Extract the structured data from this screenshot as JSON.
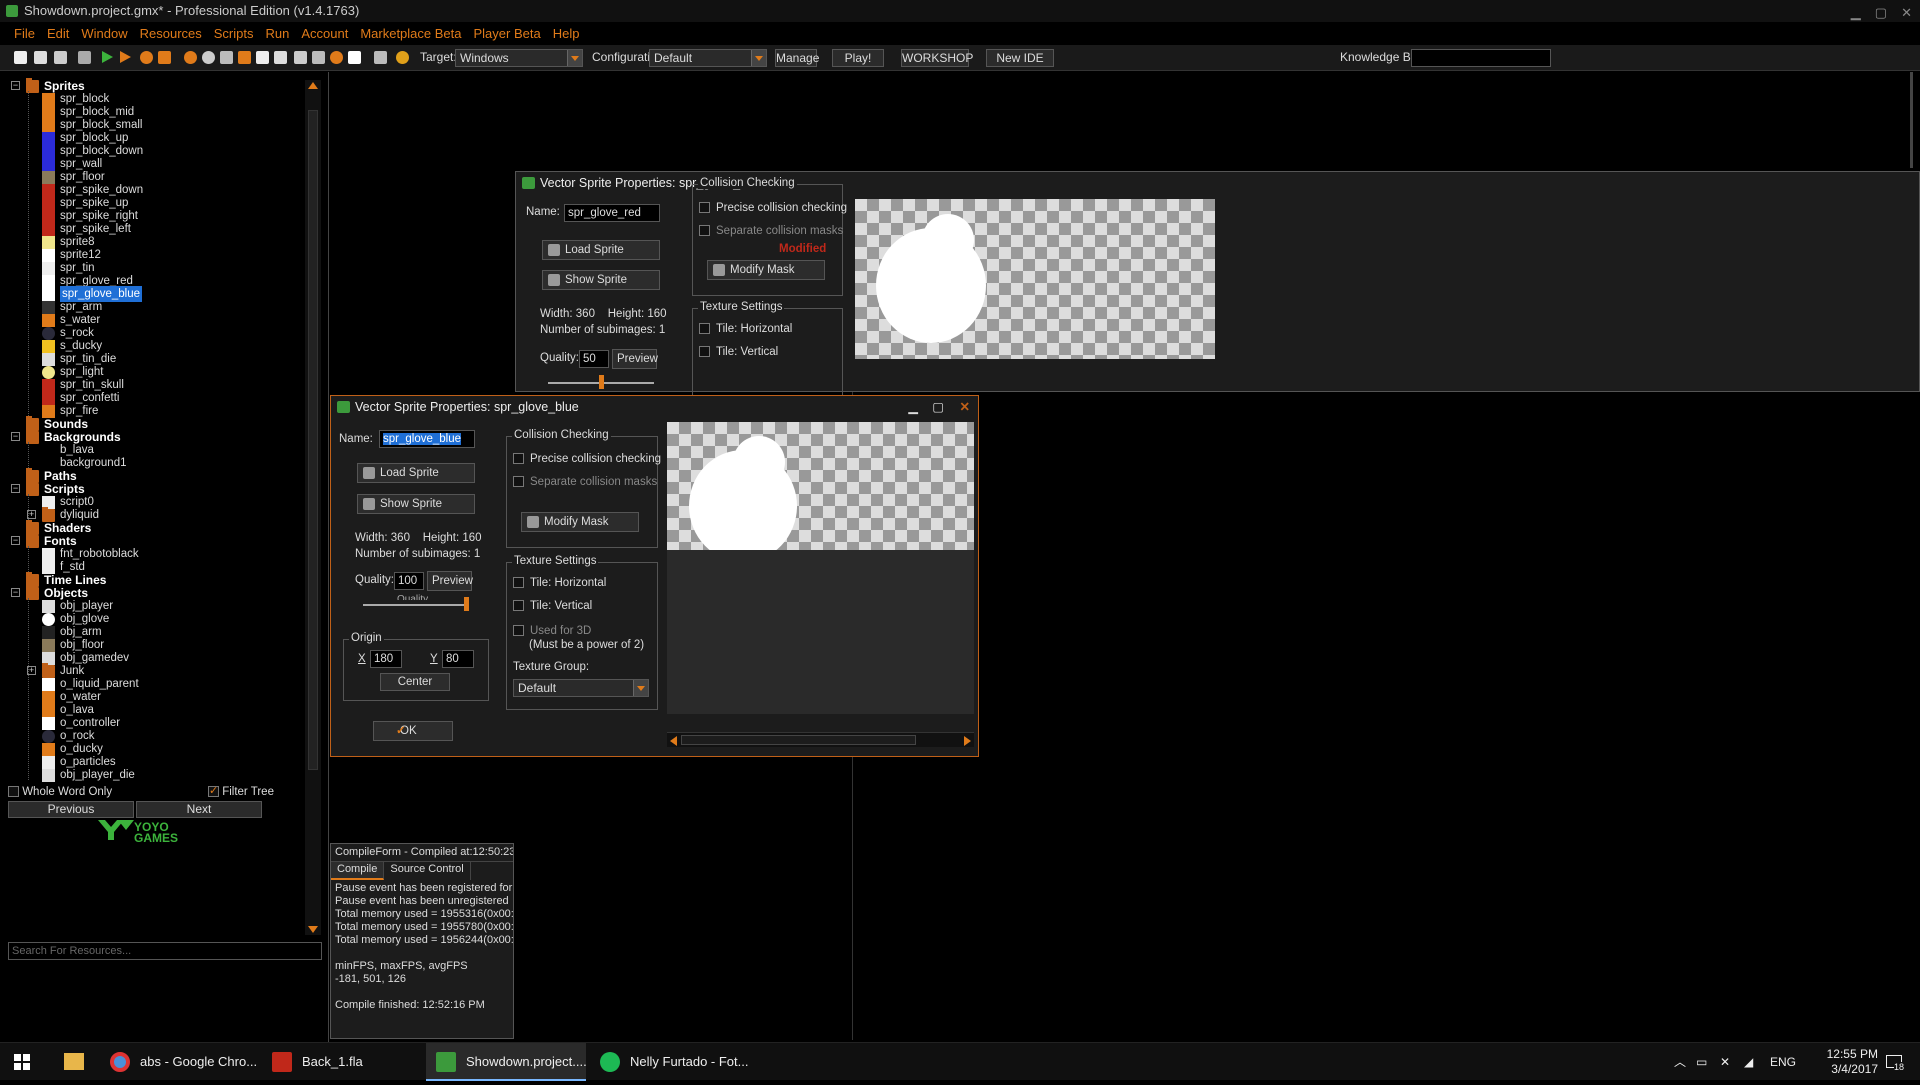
{
  "window": {
    "title": "Showdown.project.gmx* - Professional Edition (v1.4.1763)"
  },
  "menu": [
    "File",
    "Edit",
    "Window",
    "Resources",
    "Scripts",
    "Run",
    "Account",
    "Marketplace Beta",
    "Player Beta",
    "Help"
  ],
  "toolbar": {
    "target_label": "Target:",
    "target_value": "Windows",
    "config_label": "Configuration:",
    "config_value": "Default",
    "manage": "Manage",
    "play": "Play!",
    "workshop": "WORKSHOP",
    "new_ide": "New IDE",
    "kb_label": "Knowledge Base:"
  },
  "tree": {
    "sprites": "Sprites",
    "sprite_items": [
      "spr_block",
      "spr_block_mid",
      "spr_block_small",
      "spr_block_up",
      "spr_block_down",
      "spr_wall",
      "spr_floor",
      "spr_spike_down",
      "spr_spike_up",
      "spr_spike_right",
      "spr_spike_left",
      "sprite8",
      "sprite12",
      "spr_tin",
      "spr_glove_red",
      "spr_glove_blue",
      "spr_arm",
      "s_water",
      "s_rock",
      "s_ducky",
      "spr_tin_die",
      "spr_light",
      "spr_tin_skull",
      "spr_confetti",
      "spr_fire"
    ],
    "sounds": "Sounds",
    "backgrounds": "Backgrounds",
    "bg_items": [
      "b_lava",
      "background1"
    ],
    "paths": "Paths",
    "scripts": "Scripts",
    "script_items": [
      "script0",
      "dyliquid"
    ],
    "shaders": "Shaders",
    "fonts": "Fonts",
    "font_items": [
      "fnt_robotoblack",
      "f_std"
    ],
    "timelines": "Time Lines",
    "objects": "Objects",
    "object_items": [
      "obj_player",
      "obj_glove",
      "obj_arm",
      "obj_floor",
      "obj_gamedev",
      "Junk",
      "o_liquid_parent",
      "o_water",
      "o_lava",
      "o_controller",
      "o_rock",
      "o_ducky",
      "o_particles",
      "obj_player_die"
    ],
    "search_placeholder": "Search For Resources...",
    "whole_word": "Whole Word Only",
    "filter_tree": "Filter Tree",
    "previous": "Previous",
    "next": "Next",
    "logo_text": "YOYO GAMES"
  },
  "dlg_red": {
    "title": "Vector Sprite Properties: spr_glove_red",
    "name_label": "Name:",
    "name_value": "spr_glove_red",
    "load": "Load Sprite",
    "show": "Show Sprite",
    "width_height": "Width: 360    Height: 160",
    "subimages": "Number of subimages: 1",
    "quality_label": "Quality:",
    "quality_value": "50",
    "quality_fraction": 0.5,
    "preview": "Preview",
    "coll_title": "Collision Checking",
    "precise": "Precise collision checking",
    "separate": "Separate collision masks",
    "modified": "Modified",
    "modify_mask": "Modify Mask",
    "tex_title": "Texture Settings",
    "tile_h": "Tile: Horizontal",
    "tile_v": "Tile: Vertical"
  },
  "dlg_blue": {
    "title": "Vector Sprite Properties: spr_glove_blue",
    "name_label": "Name:",
    "name_value": "spr_glove_blue",
    "load": "Load Sprite",
    "show": "Show Sprite",
    "width_height": "Width: 360    Height: 160",
    "subimages": "Number of subimages: 1",
    "quality_label": "Quality:",
    "quality_value": "100",
    "quality_fraction": 1.0,
    "preview": "Preview",
    "quality_caption": "Quality",
    "origin_title": "Origin",
    "x_label": "X",
    "x_value": "180",
    "y_label": "Y",
    "y_value": "80",
    "center": "Center",
    "ok": "OK",
    "coll_title": "Collision Checking",
    "precise": "Precise collision checking",
    "separate": "Separate collision masks",
    "modify_mask": "Modify Mask",
    "tex_title": "Texture Settings",
    "tile_h": "Tile: Horizontal",
    "tile_v": "Tile: Vertical",
    "used3d": "Used for 3D",
    "used3d_note": "(Must be a power of 2)",
    "tex_group_label": "Texture Group:",
    "tex_group_value": "Default"
  },
  "compile": {
    "title": "CompileForm - Compiled at:12:50:23",
    "tab_compile": "Compile",
    "tab_source": "Source Control",
    "log": [
      "Pause event has been registered for",
      "Pause event has been unregistered",
      "Total memory used = 1955316(0x00:",
      "Total memory used = 1955780(0x00:",
      "Total memory used = 1956244(0x00:",
      "",
      "minFPS, maxFPS, avgFPS",
      "-181, 501, 126",
      "",
      "Compile finished: 12:52:16 PM"
    ]
  },
  "taskbar": {
    "chrome": "abs - Google Chro...",
    "flash": "Back_1.fla",
    "gm": "Showdown.project....",
    "spotify": "Nelly Furtado - Fot...",
    "lang": "ENG",
    "time": "12:55 PM",
    "date": "3/4/2017",
    "notif": "18"
  },
  "colors": {
    "accent": "#e07b1a",
    "selection": "#1f6fd6",
    "modified": "#c0281a"
  }
}
